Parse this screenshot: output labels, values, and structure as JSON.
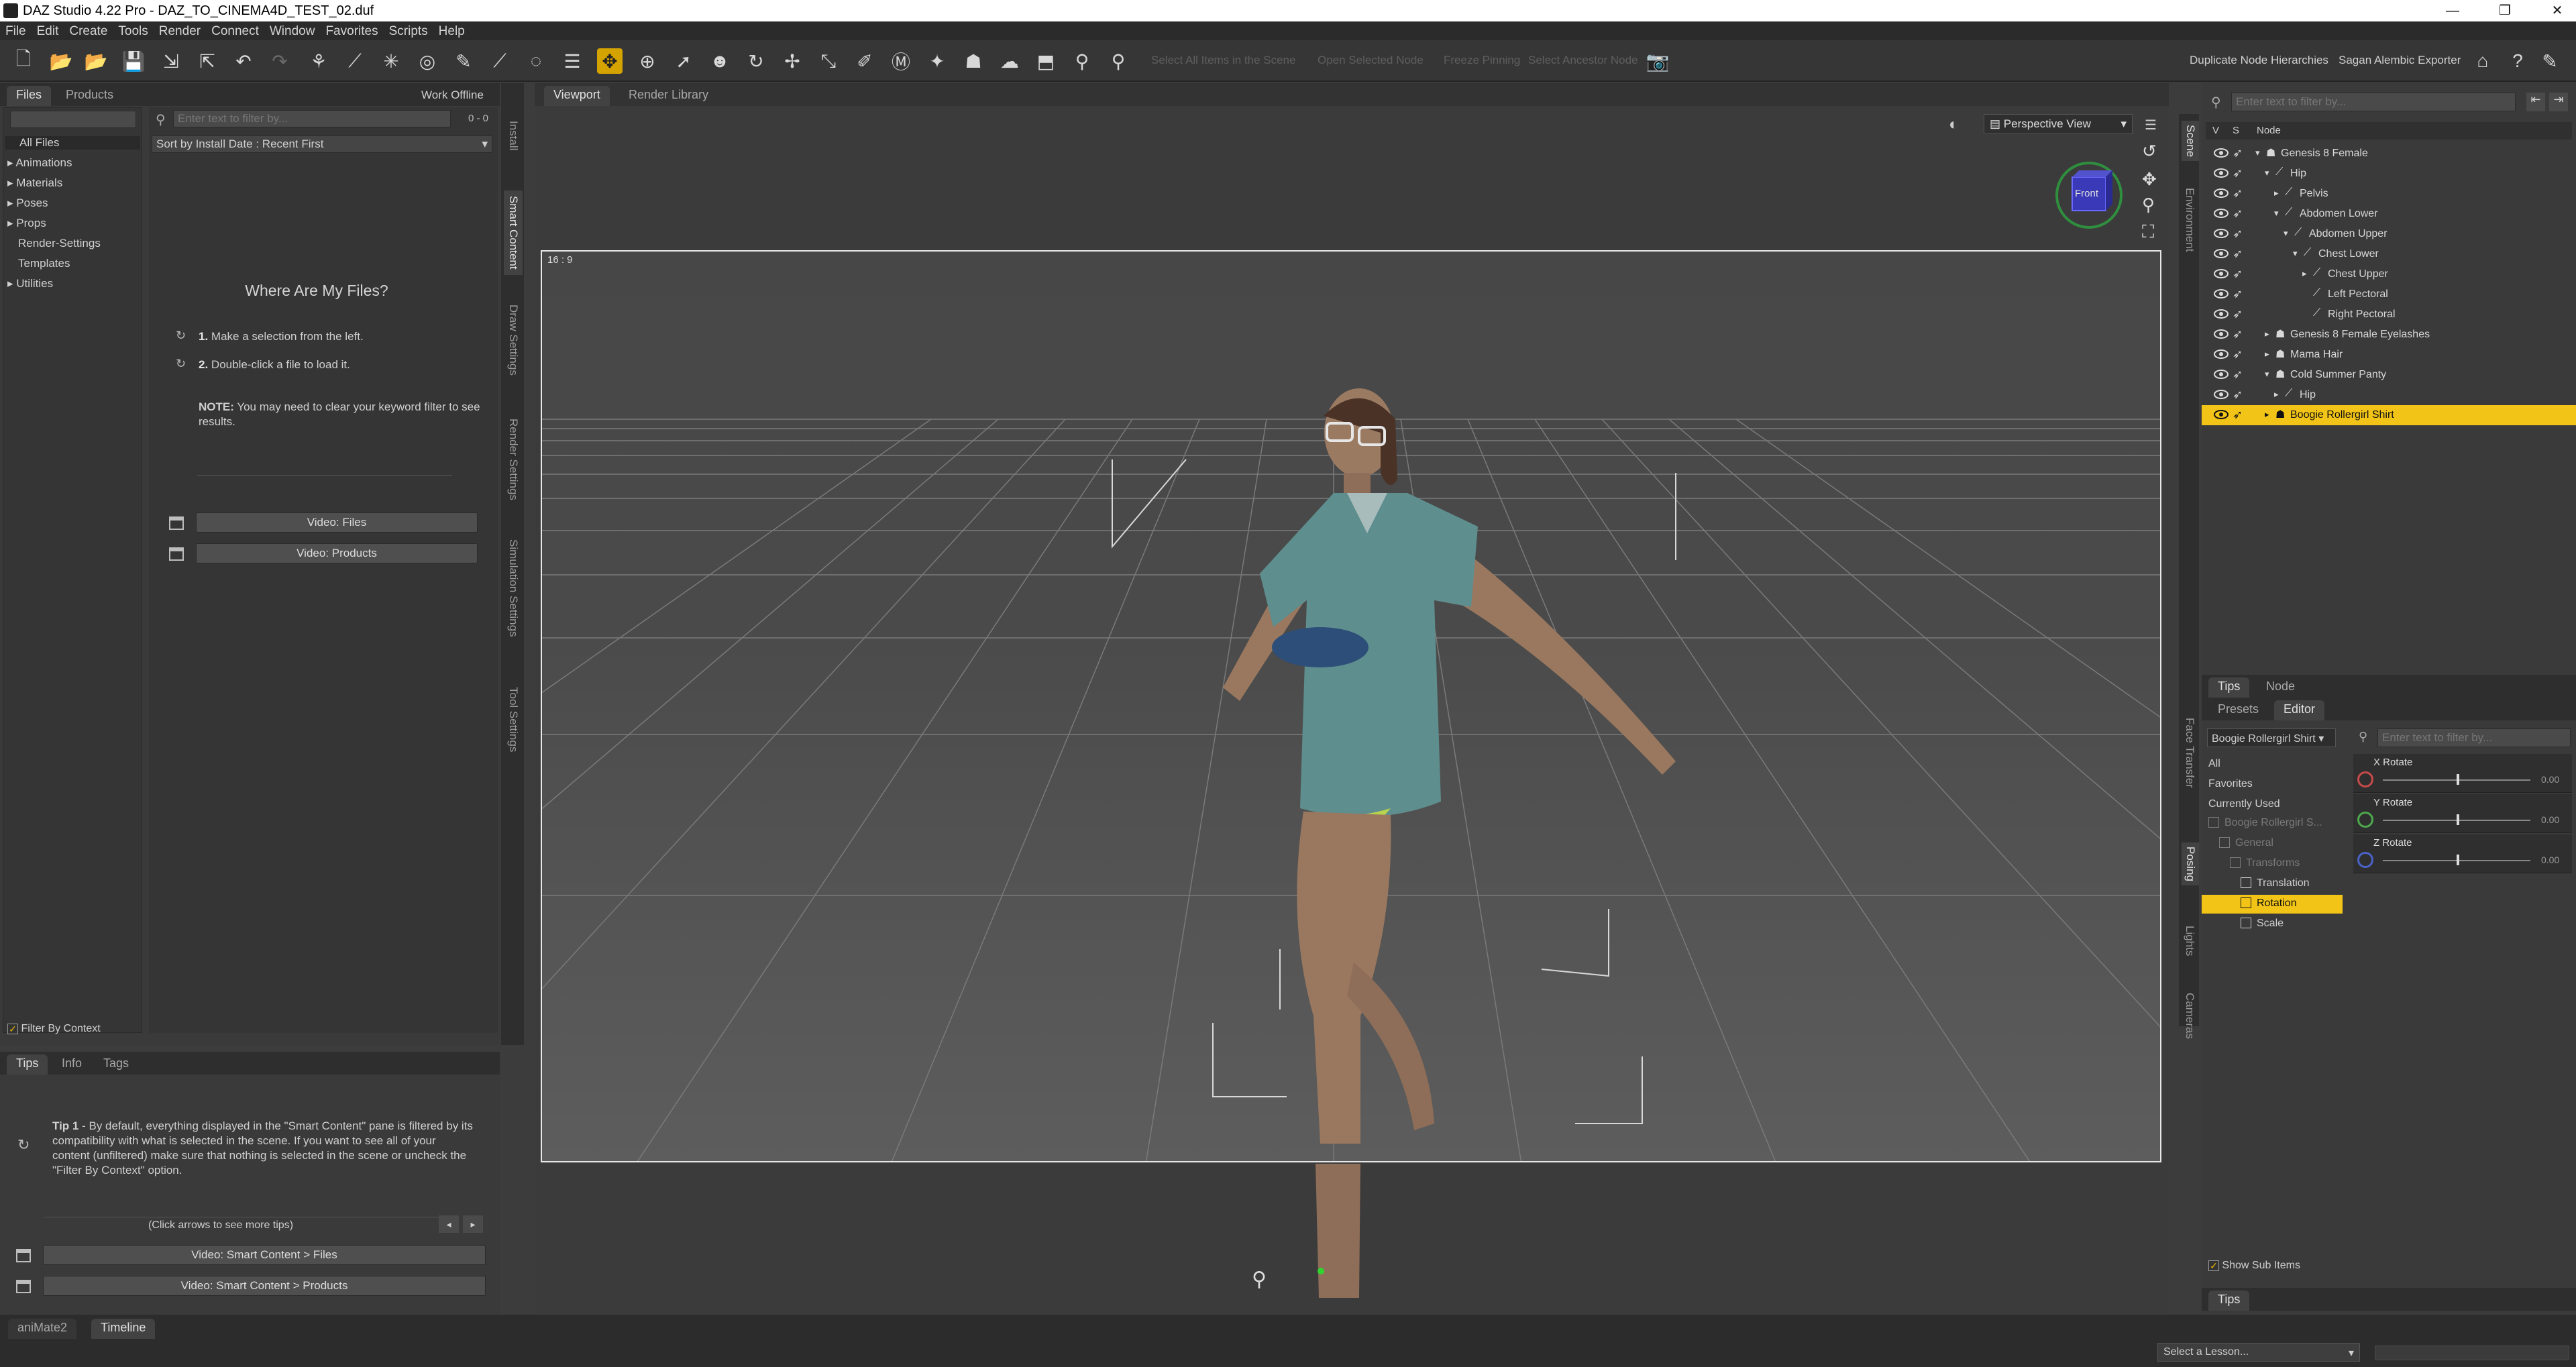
{
  "window": {
    "title": "DAZ Studio 4.22 Pro - DAZ_TO_CINEMA4D_TEST_02.duf",
    "controls": [
      "—",
      "❐",
      "✕"
    ]
  },
  "menu": [
    "File",
    "Edit",
    "Create",
    "Tools",
    "Render",
    "Connect",
    "Window",
    "Favorites",
    "Scripts",
    "Help"
  ],
  "toolbar": {
    "faded_labels": [
      "Select All Items in the Scene",
      "Open Selected Node",
      "Freeze Pinning",
      "Select Ancestor Node"
    ],
    "plugins": [
      "Duplicate Node Hierarchies",
      "Sagan Alembic Exporter"
    ]
  },
  "left": {
    "tabs": [
      "Files",
      "Products"
    ],
    "work_offline": "Work Offline",
    "search_placeholder": "Enter text to filter by...",
    "count": "0 - 0",
    "sort": "Sort by Install Date : Recent First",
    "tree": [
      {
        "label": "All Files",
        "arrow": ""
      },
      {
        "label": "Animations",
        "arrow": "▸"
      },
      {
        "label": "Materials",
        "arrow": "▸"
      },
      {
        "label": "Poses",
        "arrow": "▸"
      },
      {
        "label": "Props",
        "arrow": "▸"
      },
      {
        "label": "Render-Settings",
        "arrow": ""
      },
      {
        "label": "Templates",
        "arrow": ""
      },
      {
        "label": "Utilities",
        "arrow": "▸"
      }
    ],
    "heading": "Where Are My Files?",
    "step1_num": "1.",
    "step1": "Make a selection from the left.",
    "step2_num": "2.",
    "step2": "Double-click a file to load it.",
    "note_label": "NOTE:",
    "note": "You may need to clear your keyword filter to see results.",
    "video_files": "Video: Files",
    "video_products": "Video:  Products",
    "filter_context": "Filter By Context",
    "side_tabs": [
      "Install",
      "Smart Content",
      "Draw Settings",
      "Render Settings",
      "Simulation Settings",
      "Tool Settings"
    ]
  },
  "tips": {
    "tabs": [
      "Tips",
      "Info",
      "Tags"
    ],
    "tip_label": "Tip 1",
    "tip_text": " - By default, everything displayed in the \"Smart Content\" pane is filtered by its compatibility with what is selected in the scene. If you want to see all of your content (unfiltered) make sure that nothing is selected in the scene or uncheck the \"Filter By Context\" option.",
    "more": "(Click arrows to see more tips)",
    "video1": "Video: Smart Content > Files",
    "video2": "Video: Smart Content > Products"
  },
  "viewport": {
    "tabs": [
      "Viewport",
      "Render Library"
    ],
    "view": "Perspective View",
    "aspect": "16 : 9",
    "cube_label": "Front"
  },
  "scene": {
    "search_placeholder": "Enter text to filter by...",
    "cols": [
      "V",
      "S",
      "Node"
    ],
    "nodes": [
      {
        "label": "Genesis 8 Female",
        "arrow": "▾",
        "type": "figure",
        "depth": 0
      },
      {
        "label": "Hip",
        "arrow": "▾",
        "type": "bone",
        "depth": 1
      },
      {
        "label": "Pelvis",
        "arrow": "▸",
        "type": "bone",
        "depth": 2
      },
      {
        "label": "Abdomen Lower",
        "arrow": "▾",
        "type": "bone",
        "depth": 2
      },
      {
        "label": "Abdomen Upper",
        "arrow": "▾",
        "type": "bone",
        "depth": 3
      },
      {
        "label": "Chest Lower",
        "arrow": "▾",
        "type": "bone",
        "depth": 4
      },
      {
        "label": "Chest Upper",
        "arrow": "▸",
        "type": "bone",
        "depth": 5
      },
      {
        "label": "Left Pectoral",
        "arrow": "",
        "type": "bone",
        "depth": 5
      },
      {
        "label": "Right Pectoral",
        "arrow": "",
        "type": "bone",
        "depth": 5
      },
      {
        "label": "Genesis 8 Female Eyelashes",
        "arrow": "▸",
        "type": "figure",
        "depth": 1
      },
      {
        "label": "Mama Hair",
        "arrow": "▸",
        "type": "figure",
        "depth": 1
      },
      {
        "label": "Cold Summer Panty",
        "arrow": "▾",
        "type": "figure",
        "depth": 1
      },
      {
        "label": "Hip",
        "arrow": "▸",
        "type": "bone",
        "depth": 2
      },
      {
        "label": "Boogie Rollergirl Shirt",
        "arrow": "▸",
        "type": "figure",
        "depth": 1,
        "selected": true
      }
    ],
    "side_tabs": [
      "Scene",
      "Environment"
    ],
    "bottom_tabs": [
      "Tips",
      "Node"
    ]
  },
  "params": {
    "tabs": [
      "Presets",
      "Editor"
    ],
    "target": "Boogie Rollergirl Shirt",
    "search_placeholder": "Enter text to filter by...",
    "list": [
      "All",
      "Favorites",
      "Currently Used"
    ],
    "tree": [
      {
        "label": "Boogie Rollergirl S...",
        "depth": 0,
        "dim": true
      },
      {
        "label": "General",
        "depth": 1,
        "dim": true
      },
      {
        "label": "Transforms",
        "depth": 2,
        "dim": true
      },
      {
        "label": "Translation",
        "depth": 3
      },
      {
        "label": "Rotation",
        "depth": 3,
        "selected": true
      },
      {
        "label": "Scale",
        "depth": 3
      }
    ],
    "sliders": [
      {
        "label": "X Rotate",
        "value": "0.00",
        "color": "#c84a4a",
        "pos": 0.5
      },
      {
        "label": "Y Rotate",
        "value": "0.00",
        "color": "#4ea84e",
        "pos": 0.5
      },
      {
        "label": "Z Rotate",
        "value": "0.00",
        "color": "#4a63c8",
        "pos": 0.5
      }
    ],
    "show_sub": "Show Sub Items",
    "bottom_tab": "Tips",
    "side_tabs": [
      "Face Transfer",
      "Posing",
      "Lights",
      "Cameras"
    ]
  },
  "bottom": {
    "tabs": [
      "aniMate2",
      "Timeline"
    ],
    "lesson": "Select a Lesson..."
  },
  "colors": {
    "accent": "#f2c418",
    "panel": "#3a3a3a",
    "dark": "#2c2c2c"
  }
}
